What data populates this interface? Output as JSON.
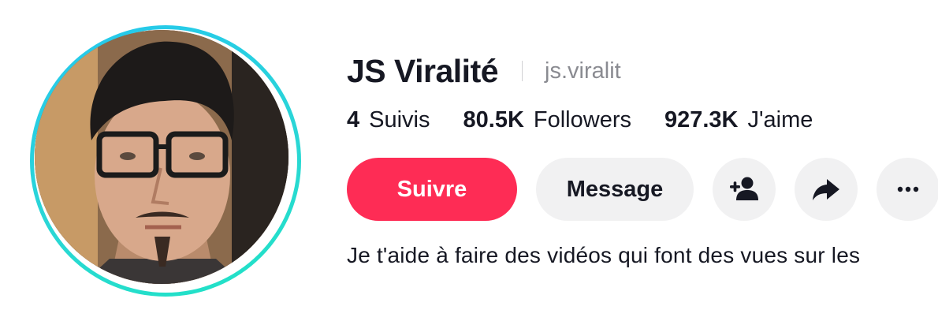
{
  "profile": {
    "display_name": "JS Viralité",
    "username": "js.viralit",
    "avatar_alt": "avatar"
  },
  "stats": [
    {
      "value": "4",
      "label": "Suivis"
    },
    {
      "value": "80.5K",
      "label": "Followers"
    },
    {
      "value": "927.3K",
      "label": "J'aime"
    }
  ],
  "actions": {
    "follow_label": "Suivre",
    "message_label": "Message",
    "add_friend_icon": "add-person-icon",
    "share_icon": "share-arrow-icon",
    "more_icon": "more-horizontal-icon"
  },
  "bio": "Je t'aide à faire des vidéos qui font des vues sur les",
  "colors": {
    "accent": "#fe2c55",
    "ring": "#25c7ee",
    "button_bg": "#f1f1f2",
    "text": "#161823",
    "muted": "#8a8b91"
  }
}
